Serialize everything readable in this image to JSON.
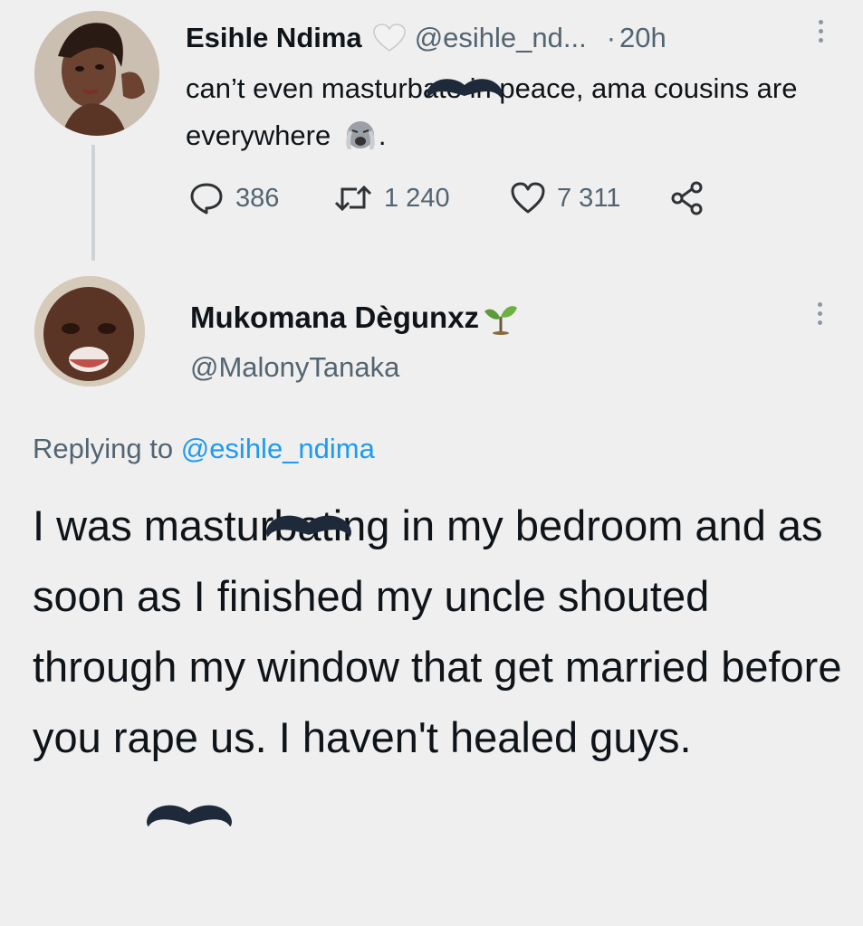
{
  "tweet1": {
    "author_name": "Esihle Ndima",
    "author_handle": "@esihle_nd...",
    "separator": "·",
    "time": "20h",
    "text": "can’t even masturbate in peace, ama cousins are everywhere",
    "text_suffix": ".",
    "reply_count": "386",
    "retweet_count": "1 240",
    "like_count": "7 311",
    "badge_icon": "white-heart-icon",
    "emoji_icon": "loudly-crying-face-icon"
  },
  "tweet2": {
    "author_name": "Mukomana Dègunxz",
    "author_handle": "@MalonyTanaka",
    "name_icon": "seedling-icon",
    "replying_prefix": "Replying to",
    "replying_handle": "@esihle_ndima",
    "text": "I was masturbating in my bedroom and as soon as I finished my uncle shouted through my window that get married before you rape us. I haven't healed guys."
  },
  "colors": {
    "text_primary": "#0f1419",
    "text_secondary": "#536471",
    "link": "#1d9bf0",
    "background": "#efefef"
  }
}
